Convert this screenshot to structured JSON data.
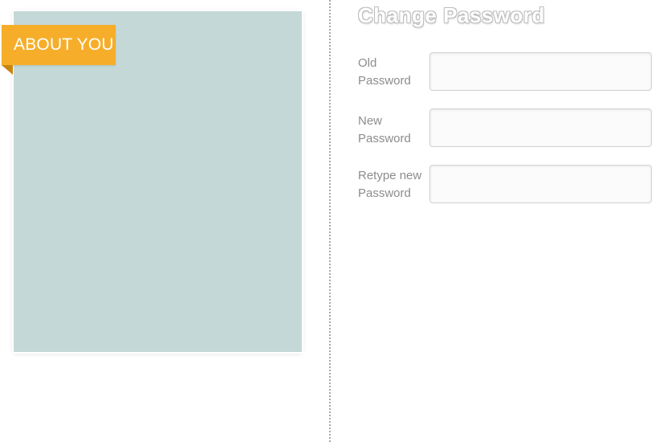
{
  "about": {
    "ribbon_label": "ABOUT YOU"
  },
  "password_section": {
    "title": "Change Password",
    "fields": [
      {
        "label_line1": "Old",
        "label_line2": "Password",
        "value": "",
        "placeholder": ""
      },
      {
        "label_line1": "New",
        "label_line2": "Password",
        "value": "",
        "placeholder": ""
      },
      {
        "label_line1": "Retype new",
        "label_line2": "Password",
        "value": "",
        "placeholder": ""
      }
    ]
  },
  "colors": {
    "card_background": "#c4d8d7",
    "ribbon_accent": "#f6ae2a",
    "label_text": "#8c8c8c"
  }
}
